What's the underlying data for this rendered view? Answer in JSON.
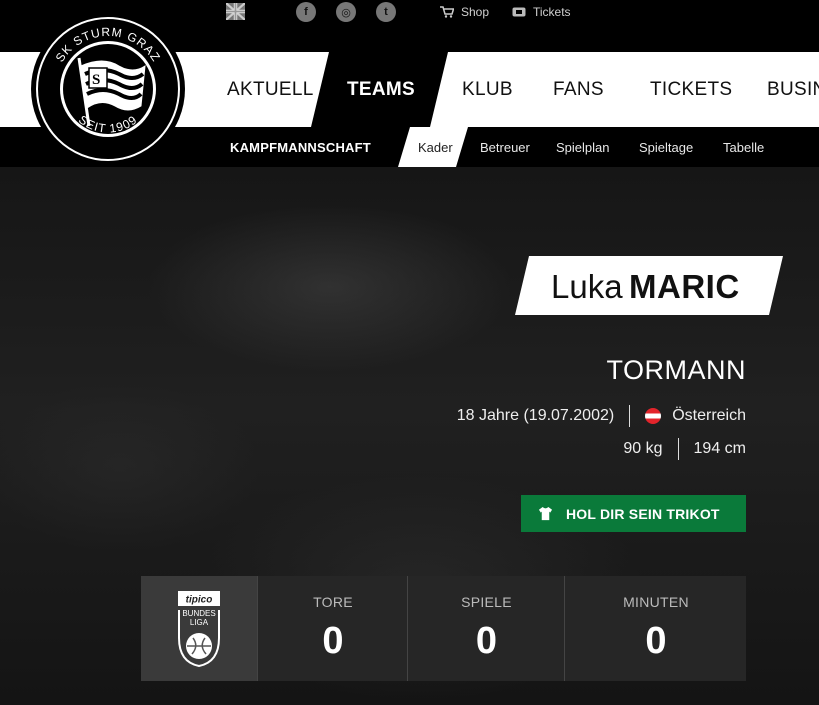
{
  "topbar": {
    "language_icon": "uk-flag-icon",
    "social": [
      {
        "icon": "facebook-icon",
        "glyph": "f"
      },
      {
        "icon": "instagram-icon",
        "glyph": "◎"
      },
      {
        "icon": "twitter-icon",
        "glyph": "t"
      }
    ],
    "shop_label": "Shop",
    "tickets_label": "Tickets"
  },
  "logo": {
    "top_text": "SK STURM GRAZ",
    "bottom_text": "SEIT 1909"
  },
  "nav": {
    "items": [
      "AKTUELL",
      "TEAMS",
      "KLUB",
      "FANS",
      "TICKETS",
      "BUSIN"
    ],
    "active": "TEAMS"
  },
  "subnav": {
    "title": "KAMPFMANNSCHAFT",
    "items": [
      "Kader",
      "Betreuer",
      "Spielplan",
      "Spieltage",
      "Tabelle"
    ],
    "active": "Kader"
  },
  "player": {
    "first_name": "Luka",
    "last_name": "MARIC",
    "position": "TORMANN",
    "age_birth": "18 Jahre (19.07.2002)",
    "nationality": "Österreich",
    "weight": "90 kg",
    "height": "194 cm"
  },
  "cta": {
    "label": "HOL DIR SEIN TRIKOT",
    "color": "#0a7a3a"
  },
  "stats": {
    "league_logo": {
      "brand": "tipico",
      "line1": "BUNDES",
      "line2": "LIGA"
    },
    "items": [
      {
        "label": "TORE",
        "value": "0"
      },
      {
        "label": "SPIELE",
        "value": "0"
      },
      {
        "label": "MINUTEN",
        "value": "0"
      }
    ]
  }
}
